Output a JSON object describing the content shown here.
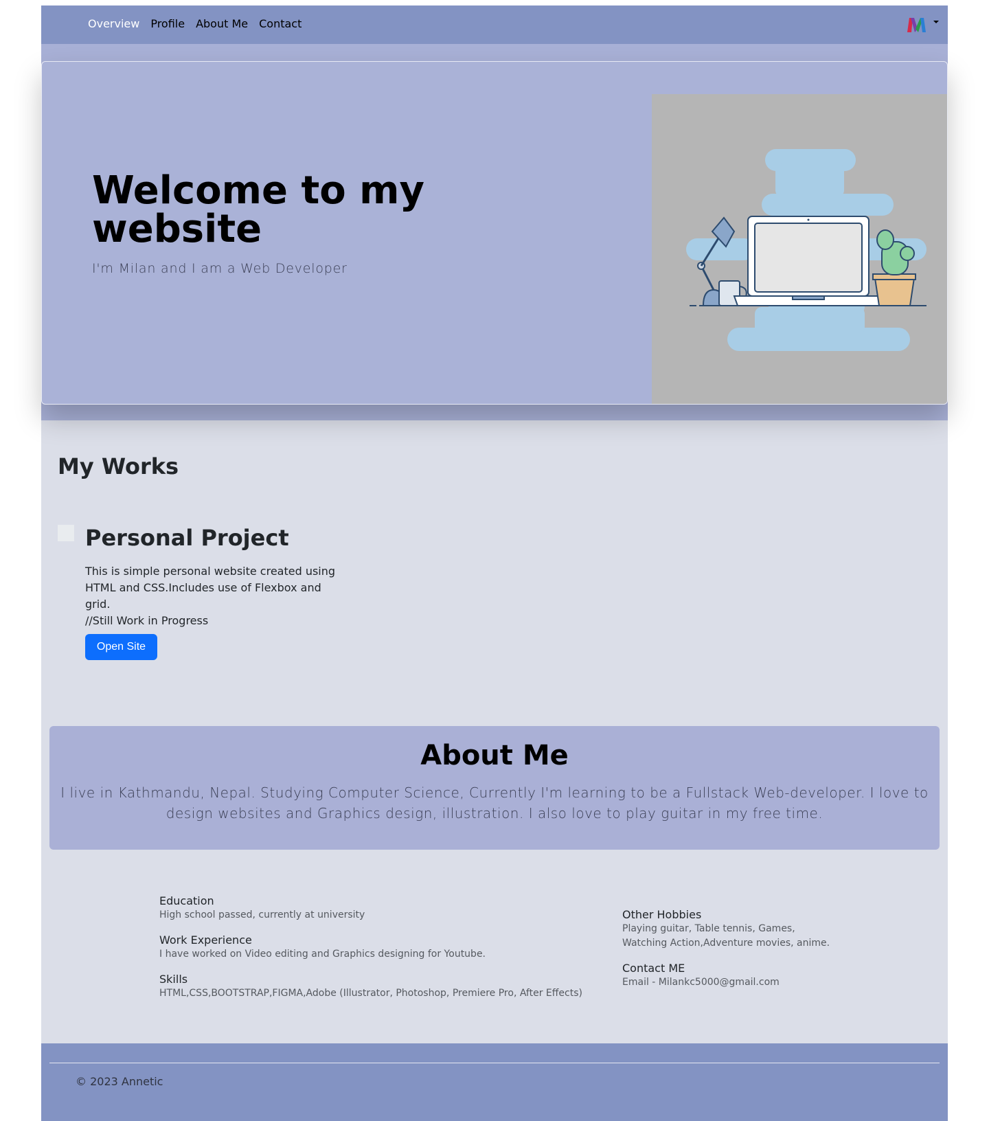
{
  "nav": {
    "links": [
      "Overview",
      "Profile",
      "About Me",
      "Contact"
    ],
    "active": "Overview"
  },
  "hero": {
    "title": "Welcome to my website",
    "subtitle": "I'm Milan and I am a Web Developer"
  },
  "works": {
    "heading": "My Works",
    "project": {
      "title": "Personal Project",
      "description": "This is simple personal website created using HTML and CSS.Includes use of Flexbox and grid.",
      "note": "//Still Work in Progress",
      "button_label": "Open Site"
    }
  },
  "about": {
    "title": "About Me",
    "text": "I live in Kathmandu, Nepal. Studying Computer Science, Currently I'm learning to be a Fullstack Web-developer. I love to design websites and Graphics design, illustration. I also love to play guitar in my free time."
  },
  "info": {
    "left": [
      {
        "heading": "Education",
        "body": "High school passed, currently at university"
      },
      {
        "heading": "Work Experience",
        "body": "I have worked on Video editing and Graphics designing for Youtube."
      },
      {
        "heading": "Skills",
        "body": "HTML,CSS,BOOTSTRAP,FIGMA,Adobe (Illustrator, Photoshop, Premiere Pro, After Effects)"
      }
    ],
    "right": [
      {
        "heading": "Other Hobbies",
        "body": "Playing guitar, Table tennis, Games, Watching Action,Adventure movies, anime."
      },
      {
        "heading": "Contact ME",
        "body": "Email - Milankc5000@gmail.com"
      }
    ]
  },
  "footer": {
    "text": "© 2023 Annetic"
  },
  "colors": {
    "nav_bg": "#8393c3",
    "hero_bg": "#aab2d7",
    "page_bg": "#dbdee8",
    "button_bg": "#0d6efd"
  },
  "icons": [
    "logo-m-icon",
    "caret-down-icon",
    "desk-illustration",
    "project-thumbnail-icon"
  ]
}
